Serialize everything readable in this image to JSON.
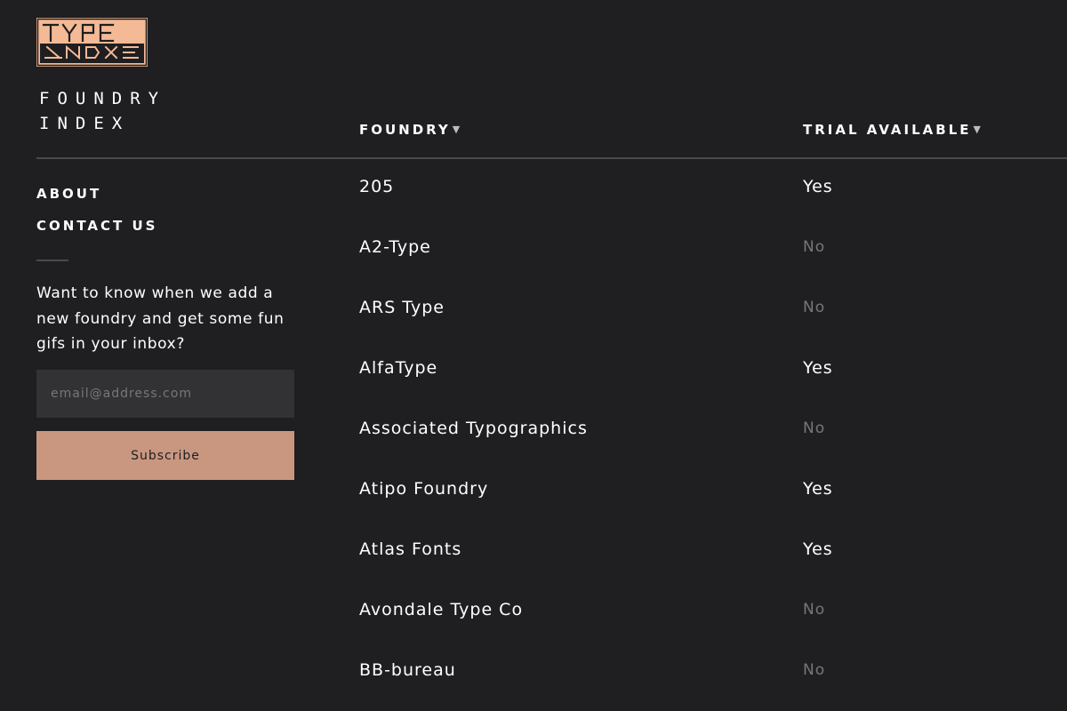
{
  "brand": {
    "logo_text": "TYPE INDEX",
    "logo_color": "#f4b995",
    "name_lines": [
      "FOUNDRY",
      "INDEX"
    ]
  },
  "sidebar": {
    "nav": [
      {
        "label": "ABOUT"
      },
      {
        "label": "CONTACT US"
      }
    ],
    "newsletter_text": "Want to know when we add a new foundry and get some fun gifs in your inbox?",
    "email_placeholder": "email@address.com",
    "subscribe_label": "Subscribe"
  },
  "table": {
    "columns": [
      {
        "label": "FOUNDRY",
        "sort_icon": "triangle-down-icon"
      },
      {
        "label": "TRIAL AVAILABLE",
        "sort_icon": "triangle-down-icon"
      }
    ],
    "rows": [
      {
        "name": "205",
        "trial": "Yes"
      },
      {
        "name": "A2-Type",
        "trial": "No"
      },
      {
        "name": "ARS Type",
        "trial": "No"
      },
      {
        "name": "AlfaType",
        "trial": "Yes"
      },
      {
        "name": "Associated Typographics",
        "trial": "No"
      },
      {
        "name": "Atipo Foundry",
        "trial": "Yes"
      },
      {
        "name": "Atlas Fonts",
        "trial": "Yes"
      },
      {
        "name": "Avondale Type Co",
        "trial": "No"
      },
      {
        "name": "BB-bureau",
        "trial": "No"
      }
    ]
  },
  "colors": {
    "background": "#1f1e20",
    "accent": "#c99780",
    "input_bg": "#323134",
    "muted_text": "#77767a"
  }
}
